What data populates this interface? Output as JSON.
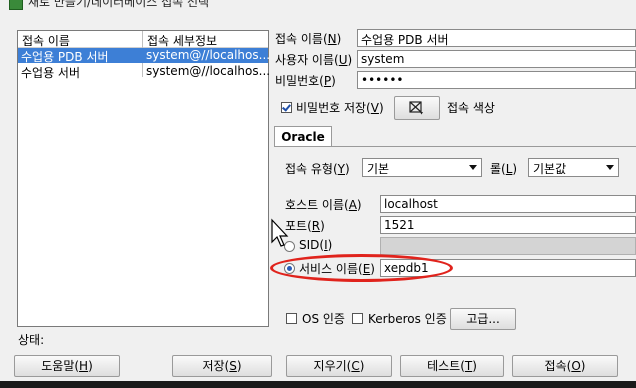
{
  "window": {
    "title": "새로 만들기/데이터베이스 접속 선택"
  },
  "connection_list": {
    "headers": [
      "접속 이름",
      "접속 세부정보"
    ],
    "rows": [
      {
        "name": "수업용 PDB 서버",
        "details": "system@//localhos...",
        "selected": true
      },
      {
        "name": "수업용 서버",
        "details": "system@//localhos...",
        "selected": false
      }
    ]
  },
  "form": {
    "conn_name": {
      "label_pre": "접속 이름(",
      "key": "N",
      "label_post": ")",
      "value": "수업용 PDB 서버"
    },
    "username": {
      "label_pre": "사용자 이름(",
      "key": "U",
      "label_post": ")",
      "value": "system"
    },
    "password": {
      "label_pre": "비밀번호(",
      "key": "P",
      "label_post": ")",
      "value": "••••••"
    },
    "save_password": {
      "label_pre": "비밀번호 저장(",
      "key": "V",
      "label_post": ")",
      "checked": true
    },
    "conn_color_label": "접속 색상"
  },
  "tabs": [
    {
      "label": "Oracle",
      "active": true
    }
  ],
  "oracle": {
    "conn_type": {
      "label_pre": "접속 유형(",
      "key": "Y",
      "label_post": ")",
      "value": "기본"
    },
    "role": {
      "label_pre": "롤(",
      "key": "L",
      "label_post": ")",
      "value": "기본값"
    },
    "hostname": {
      "label_pre": "호스트 이름(",
      "key": "A",
      "label_post": ")",
      "value": "localhost"
    },
    "port": {
      "label_pre": "포트(",
      "key": "R",
      "label_post": ")",
      "value": "1521"
    },
    "sid": {
      "label_pre": "SID(",
      "key": "I",
      "label_post": ")",
      "selected": false,
      "value": ""
    },
    "service_name": {
      "label_pre": "서비스 이름(",
      "key": "E",
      "label_post": ")",
      "selected": true,
      "value": "xepdb1"
    },
    "os_auth": {
      "label": "OS 인증",
      "checked": false
    },
    "kerberos_auth": {
      "label": "Kerberos 인증",
      "checked": false
    },
    "advanced_label": "고급..."
  },
  "status_label": "상태:",
  "buttons": {
    "help": {
      "pre": "도움말(",
      "key": "H",
      "post": ")"
    },
    "save": {
      "pre": "저장(",
      "key": "S",
      "post": ")"
    },
    "clear": {
      "pre": "지우기(",
      "key": "C",
      "post": ")"
    },
    "test": {
      "pre": "테스트(",
      "key": "T",
      "post": ")"
    },
    "connect": {
      "pre": "접속(",
      "key": "O",
      "post": ")"
    }
  },
  "annotation_color": "#e0231c",
  "selection_color": "#3d7fd6"
}
